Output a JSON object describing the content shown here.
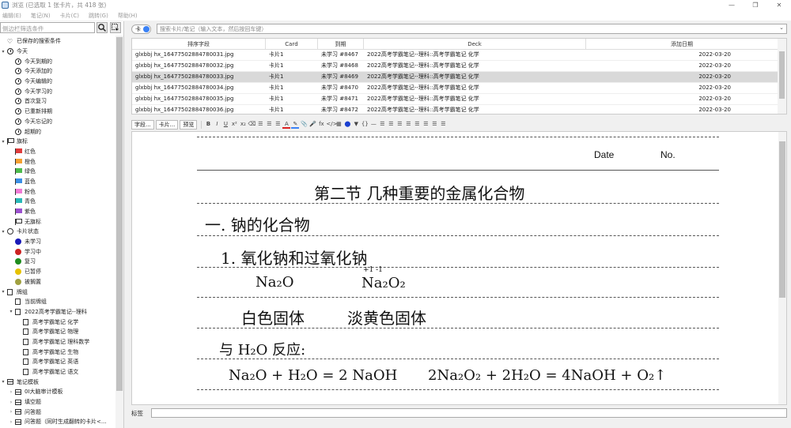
{
  "window": {
    "title": "浏览 (已选取 1 张卡片，共 418 张)",
    "controls": [
      "—",
      "❐",
      "✕"
    ]
  },
  "menu": [
    "编辑(E)",
    "笔记(N)",
    "卡片(C)",
    "跳转(G)",
    "帮助(H)"
  ],
  "sidebar": {
    "search_placeholder": "侧边栏筛选条件",
    "items": [
      {
        "label": "已保存的搜索条件",
        "level": 0,
        "arrow": "",
        "icon": "heart-icon"
      },
      {
        "label": "今天",
        "level": 0,
        "arrow": "▾",
        "icon": "clock-icon"
      },
      {
        "label": "今天到期的",
        "level": 1,
        "arrow": "",
        "icon": "clock-icon"
      },
      {
        "label": "今天添加的",
        "level": 1,
        "arrow": "",
        "icon": "clock-icon"
      },
      {
        "label": "今天编辑的",
        "level": 1,
        "arrow": "",
        "icon": "clock-icon"
      },
      {
        "label": "今天学习的",
        "level": 1,
        "arrow": "",
        "icon": "clock-icon"
      },
      {
        "label": "首次复习",
        "level": 1,
        "arrow": "",
        "icon": "clock-icon"
      },
      {
        "label": "已重新排期",
        "level": 1,
        "arrow": "",
        "icon": "clock-icon"
      },
      {
        "label": "今天忘记的",
        "level": 1,
        "arrow": "",
        "icon": "clock-icon"
      },
      {
        "label": "超期的",
        "level": 1,
        "arrow": "",
        "icon": "clock-icon"
      },
      {
        "label": "旗标",
        "level": 0,
        "arrow": "▾",
        "icon": "flag-icon",
        "color": ""
      },
      {
        "label": "红色",
        "level": 1,
        "arrow": "",
        "icon": "flag-icon",
        "color": "#e03c3c"
      },
      {
        "label": "橙色",
        "level": 1,
        "arrow": "",
        "icon": "flag-icon",
        "color": "#f5a030"
      },
      {
        "label": "绿色",
        "level": 1,
        "arrow": "",
        "icon": "flag-icon",
        "color": "#4cbb4c"
      },
      {
        "label": "蓝色",
        "level": 1,
        "arrow": "",
        "icon": "flag-icon",
        "color": "#3a8ee6"
      },
      {
        "label": "粉色",
        "level": 1,
        "arrow": "",
        "icon": "flag-icon",
        "color": "#f07ad6"
      },
      {
        "label": "青色",
        "level": 1,
        "arrow": "",
        "icon": "flag-icon",
        "color": "#27b8b8"
      },
      {
        "label": "紫色",
        "level": 1,
        "arrow": "",
        "icon": "flag-icon",
        "color": "#9b4fcf"
      },
      {
        "label": "无旗标",
        "level": 1,
        "arrow": "",
        "icon": "flag-icon",
        "color": ""
      },
      {
        "label": "卡片状态",
        "level": 0,
        "arrow": "▾",
        "icon": "circle-icon"
      },
      {
        "label": "未学习",
        "level": 1,
        "arrow": "",
        "icon": "dot-icon",
        "color": "#1a1ab8"
      },
      {
        "label": "学习中",
        "level": 1,
        "arrow": "",
        "icon": "dot-icon",
        "color": "#cc2222"
      },
      {
        "label": "复习",
        "level": 1,
        "arrow": "",
        "icon": "dot-icon",
        "color": "#1e8c1e"
      },
      {
        "label": "已暂停",
        "level": 1,
        "arrow": "",
        "icon": "dot-icon",
        "color": "#e6c200"
      },
      {
        "label": "被搁置",
        "level": 1,
        "arrow": "",
        "icon": "dot-icon",
        "color": "#a0a040"
      },
      {
        "label": "牌组",
        "level": 0,
        "arrow": "▾",
        "icon": "deck-icon"
      },
      {
        "label": "当前牌组",
        "level": 1,
        "arrow": "",
        "icon": "deck-icon"
      },
      {
        "label": "2022高考学霸笔记--理科",
        "level": 1,
        "arrow": "▾",
        "icon": "deck-icon"
      },
      {
        "label": "高考学霸笔记 化学",
        "level": 2,
        "arrow": "",
        "icon": "deck-icon"
      },
      {
        "label": "高考学霸笔记 物理",
        "level": 2,
        "arrow": "",
        "icon": "deck-icon"
      },
      {
        "label": "高考学霸笔记 理科数学",
        "level": 2,
        "arrow": "",
        "icon": "deck-icon"
      },
      {
        "label": "高考学霸笔记 生物",
        "level": 2,
        "arrow": "",
        "icon": "deck-icon"
      },
      {
        "label": "高考学霸笔记 英语",
        "level": 2,
        "arrow": "",
        "icon": "deck-icon"
      },
      {
        "label": "高考学霸笔记 语文",
        "level": 2,
        "arrow": "",
        "icon": "deck-icon"
      },
      {
        "label": "笔记模板",
        "level": 0,
        "arrow": "▾",
        "icon": "note-type-icon"
      },
      {
        "label": "0I大脑审计模板",
        "level": 1,
        "arrow": "›",
        "icon": "note-type-icon"
      },
      {
        "label": "填空题",
        "level": 1,
        "arrow": "›",
        "icon": "note-type-icon"
      },
      {
        "label": "问答题",
        "level": 1,
        "arrow": "›",
        "icon": "note-type-icon"
      },
      {
        "label": "问答题（同时生成翻转的卡片<...",
        "level": 1,
        "arrow": "›",
        "icon": "note-type-icon"
      }
    ]
  },
  "search": {
    "toggle_label": "卡",
    "placeholder": "搜索卡片/笔记（输入文本，然后按回车键）"
  },
  "table": {
    "columns": [
      "排序字段",
      "Card",
      "到期",
      "Deck",
      "添加日期"
    ],
    "rows": [
      [
        "glxbbj hx_16477502884780031.jpg",
        "卡片1",
        "未学习 #8467",
        "2022高考学霸笔记--理科::高考学霸笔记 化学",
        "2022-03-20"
      ],
      [
        "glxbbj hx_16477502884780032.jpg",
        "卡片1",
        "未学习 #8468",
        "2022高考学霸笔记--理科::高考学霸笔记 化学",
        "2022-03-20"
      ],
      [
        "glxbbj hx_16477502884780033.jpg",
        "卡片1",
        "未学习 #8469",
        "2022高考学霸笔记--理科::高考学霸笔记 化学",
        "2022-03-20"
      ],
      [
        "glxbbj hx_16477502884780034.jpg",
        "卡片1",
        "未学习 #8470",
        "2022高考学霸笔记--理科::高考学霸笔记 化学",
        "2022-03-20"
      ],
      [
        "glxbbj hx_16477502884780035.jpg",
        "卡片1",
        "未学习 #8471",
        "2022高考学霸笔记--理科::高考学霸笔记 化学",
        "2022-03-20"
      ],
      [
        "glxbbj hx_16477502884780036.jpg",
        "卡片1",
        "未学习 #8472",
        "2022高考学霸笔记--理科::高考学霸笔记 化学",
        "2022-03-20"
      ]
    ],
    "selected_row": 2
  },
  "editor_toolbar": {
    "fields_label": "字段...",
    "cards_label": "卡片...",
    "preview_label": "预览",
    "format_icons": [
      "B",
      "I",
      "U",
      "x²",
      "x₂",
      "⌫",
      "☰",
      "☰",
      "☰",
      "A",
      "✎",
      "📎",
      "🎤",
      "fx",
      "</>",
      "▦",
      "⬤",
      "▼",
      "{}",
      "—",
      "☰",
      "☰",
      "☰",
      "☰",
      "☰",
      "☰",
      "☰",
      "☰"
    ]
  },
  "note": {
    "date_label": "Date",
    "no_label": "No.",
    "heading": "第二节  几种重要的金属化合物",
    "lines": [
      "一. 钠的化合物",
      "1. 氧化钠和过氧化钠",
      "Na₂O",
      "Na₂O₂",
      "+1  -1",
      "白色固体",
      "淡黄色固体",
      "与 H₂O 反应:",
      "Na₂O + H₂O = 2 NaOH",
      "2Na₂O₂ + 2H₂O = 4NaOH + O₂↑"
    ]
  },
  "tags": {
    "label": "标签"
  }
}
